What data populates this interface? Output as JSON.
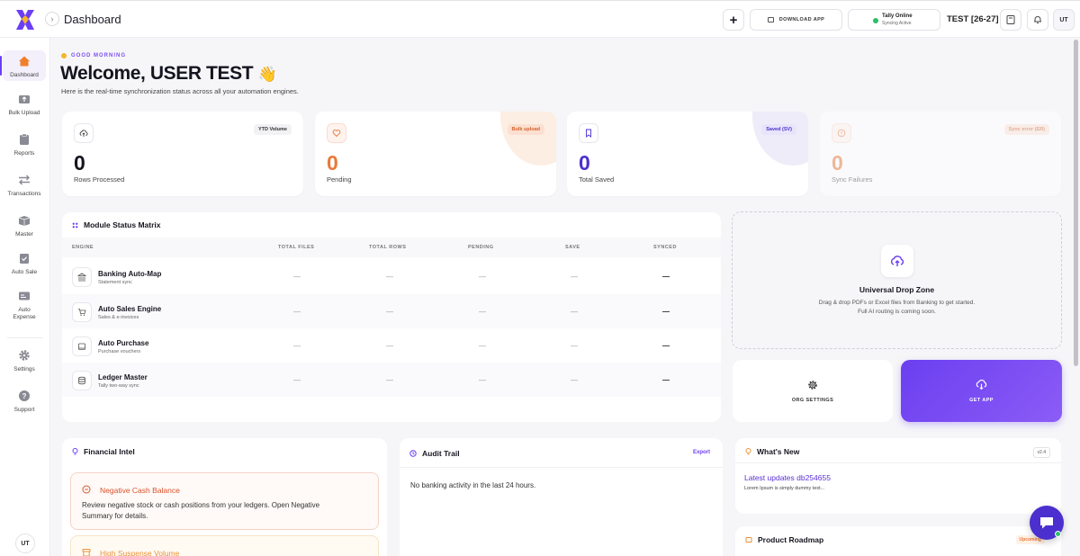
{
  "colors": {
    "accent": "#6b3df5",
    "orange": "#e8793a",
    "green": "#2ebd6b",
    "purple_dark": "#4b2fcf"
  },
  "topbar": {
    "title": "Dashboard",
    "download_label": "DOWNLOAD APP",
    "tally_status": "Tally Online",
    "tally_sub": "Syncing Active",
    "fy_label": "TEST [26-27]",
    "avatar_initials": "UT"
  },
  "sidebar": {
    "items": [
      {
        "label": "Dashboard",
        "icon": "home-icon"
      },
      {
        "label": "Bulk Upload",
        "icon": "upload-icon"
      },
      {
        "label": "Reports",
        "icon": "clipboard-icon"
      },
      {
        "label": "Transactions",
        "icon": "swap-icon"
      },
      {
        "label": "Master",
        "icon": "layers-icon"
      },
      {
        "label": "Auto Sale",
        "icon": "clipboard-check-icon"
      },
      {
        "label": "Auto Expense",
        "icon": "card-icon"
      },
      {
        "label": "Settings",
        "icon": "gear-icon"
      },
      {
        "label": "Support",
        "icon": "help-icon"
      }
    ],
    "avatar_initials": "UT"
  },
  "greeting": {
    "small": "GOOD MORNING",
    "welcome": "Welcome, USER TEST",
    "subtitle": "Here is the real-time synchronization status across all your automation engines."
  },
  "stats": [
    {
      "value": "0",
      "label": "Rows Processed",
      "badge": "YTD Volume"
    },
    {
      "value": "0",
      "label": "Pending",
      "badge": "Bulk upload"
    },
    {
      "value": "0",
      "label": "Total Saved",
      "badge": "Saved (SV)"
    },
    {
      "value": "0",
      "label": "Sync Failures",
      "badge": "Sync error (ER)"
    }
  ],
  "matrix": {
    "title": "Module Status Matrix",
    "columns": [
      "ENGINE",
      "TOTAL FILES",
      "TOTAL ROWS",
      "PENDING",
      "SAVE",
      "SYNCED"
    ],
    "rows": [
      {
        "name": "Banking Auto-Map",
        "sub": "Statement sync",
        "cells": [
          "—",
          "—",
          "—",
          "—",
          "—"
        ]
      },
      {
        "name": "Auto Sales Engine",
        "sub": "Sales & e-invoices",
        "cells": [
          "—",
          "—",
          "—",
          "—",
          "—"
        ]
      },
      {
        "name": "Auto Purchase",
        "sub": "Purchase vouchers",
        "cells": [
          "—",
          "—",
          "—",
          "—",
          "—"
        ]
      },
      {
        "name": "Ledger Master",
        "sub": "Tally two-way sync",
        "cells": [
          "—",
          "—",
          "—",
          "—",
          "—"
        ]
      }
    ]
  },
  "dropzone": {
    "title": "Universal Drop Zone",
    "subtitle": "Drag & drop PDFs or Excel files from Banking to get started. Full AI routing is coming soon."
  },
  "actions": {
    "org_settings": "ORG SETTINGS",
    "get_app": "GET APP"
  },
  "financial": {
    "title": "Financial Intel",
    "alerts": [
      {
        "title": "Negative Cash Balance",
        "desc": "Review negative stock or cash positions from your ledgers. Open Negative Summary for details."
      },
      {
        "title": "High Suspense Volume"
      }
    ]
  },
  "audit": {
    "title": "Audit Trail",
    "export": "Export",
    "empty": "No banking activity in the last 24 hours."
  },
  "news": {
    "title": "What's New",
    "version": "v2.4",
    "link": "Latest updates db254655",
    "sub": "Lorem Ipsum is simply dummy text..."
  },
  "roadmap": {
    "title": "Product Roadmap",
    "badge": "Upcoming"
  }
}
